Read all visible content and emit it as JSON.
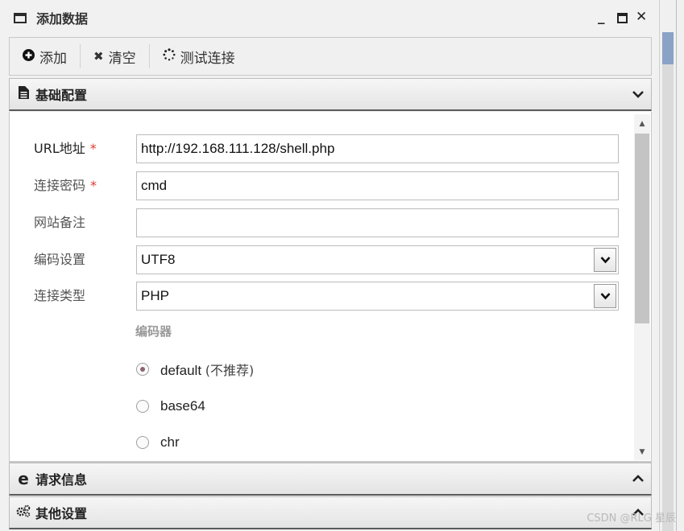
{
  "window": {
    "title": "添加数据"
  },
  "toolbar": {
    "add_label": "添加",
    "clear_label": "清空",
    "test_label": "测试连接"
  },
  "panels": {
    "basic": "基础配置",
    "request": "请求信息",
    "other": "其他设置"
  },
  "form": {
    "url_label": "URL地址",
    "url_value": "http://192.168.111.128/shell.php",
    "password_label": "连接密码",
    "password_value": "cmd",
    "note_label": "网站备注",
    "note_value": "",
    "encoding_label": "编码设置",
    "encoding_value": "UTF8",
    "type_label": "连接类型",
    "type_value": "PHP",
    "required_mark": "*",
    "encoder_heading": "编码器",
    "encoders": [
      {
        "label": "default",
        "hint": "(不推荐)",
        "selected": true
      },
      {
        "label": "base64",
        "hint": "",
        "selected": false
      },
      {
        "label": "chr",
        "hint": "",
        "selected": false
      }
    ]
  },
  "watermark": "CSDN @RLG 星辰"
}
